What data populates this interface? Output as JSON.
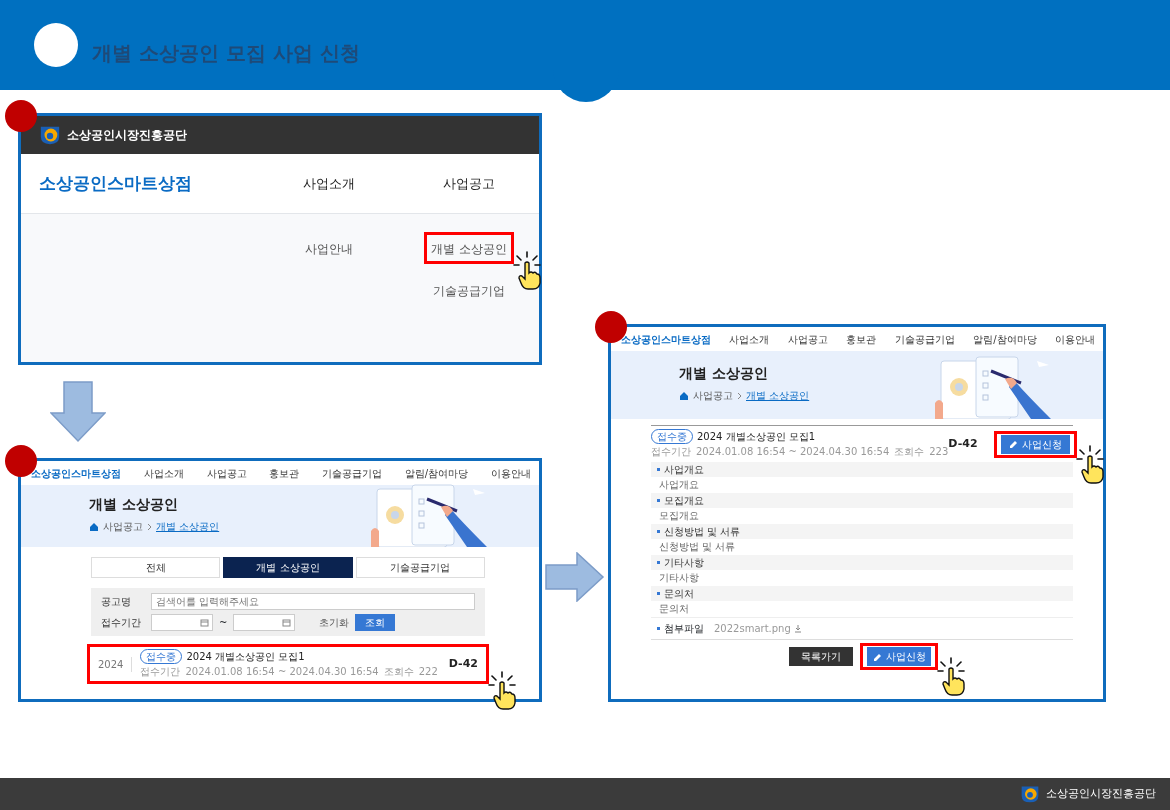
{
  "slide": {
    "title": "개별 소상공인 모집 사업 신청"
  },
  "step1": {
    "org_name": "소상공인시장진흥공단",
    "site_logo": "소상공인스마트상점",
    "menu": [
      {
        "label": "사업소개",
        "children": [
          {
            "label": "사업안내",
            "highlighted": false
          }
        ]
      },
      {
        "label": "사업공고",
        "children": [
          {
            "label": "개별 소상공인",
            "highlighted": true
          },
          {
            "label": "기술공급기업",
            "highlighted": false
          }
        ]
      }
    ]
  },
  "step2": {
    "site_logo": "소상공인스마트상점",
    "nav": [
      "사업소개",
      "사업공고",
      "홍보관",
      "기술공급기업",
      "알림/참여마당",
      "이용안내"
    ],
    "page_title": "개별 소상공인",
    "breadcrumb": [
      "사업공고",
      "개별 소상공인"
    ],
    "tabs": [
      {
        "label": "전체",
        "selected": false
      },
      {
        "label": "개별 소상공인",
        "selected": true
      },
      {
        "label": "기술공급기업",
        "selected": false
      }
    ],
    "search": {
      "name_label": "공고명",
      "placeholder": "검색어를 입력해주세요",
      "period_label": "접수기간",
      "separator": "~",
      "reset": "초기화",
      "submit": "조회"
    },
    "results": [
      {
        "year": "2024",
        "status": "접수중",
        "title": "2024 개별소상공인 모집1",
        "period_label": "접수기간",
        "period": "2024.01.08 16:54 ~ 2024.04.30 16:54",
        "views_label": "조회수",
        "views": "222",
        "dday": "D-42",
        "highlighted": true
      }
    ]
  },
  "step3": {
    "site_logo": "소상공인스마트상점",
    "nav": [
      "사업소개",
      "사업공고",
      "홍보관",
      "기술공급기업",
      "알림/참여마당",
      "이용안내"
    ],
    "page_title": "개별 소상공인",
    "breadcrumb": [
      "사업공고",
      "개별 소상공인"
    ],
    "notice": {
      "status": "접수중",
      "title": "2024 개별소상공인 모집1",
      "period_label": "접수기간",
      "period": "2024.01.08 16:54 ~ 2024.04.30 16:54",
      "views_label": "조회수",
      "views": "223",
      "dday": "D-42",
      "apply_button": {
        "label": "사업신청",
        "highlighted": true
      }
    },
    "sections": [
      {
        "heading": "사업개요",
        "body": "사업개요"
      },
      {
        "heading": "모집개요",
        "body": "모집개요"
      },
      {
        "heading": "신청방법 및 서류",
        "body": "신청방법 및 서류"
      },
      {
        "heading": "기타사항",
        "body": "기타사항"
      },
      {
        "heading": "문의처",
        "body": "문의처"
      }
    ],
    "attachment": {
      "label": "첨부파일",
      "file": "2022smart.png"
    },
    "buttons": [
      {
        "kind": "dark",
        "label": "목록가기",
        "highlighted": false
      },
      {
        "kind": "primary",
        "label": "사업신청",
        "highlighted": true
      }
    ]
  },
  "footer": {
    "org_name": "소상공인시장진흥공단"
  }
}
